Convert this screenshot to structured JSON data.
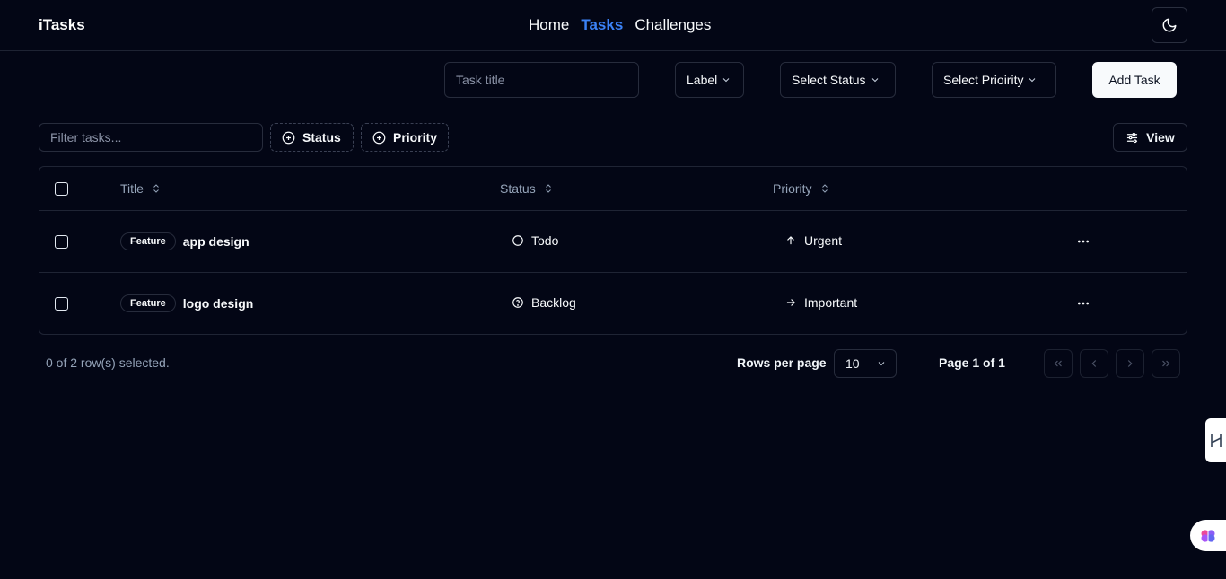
{
  "app": {
    "brand": "iTasks"
  },
  "nav": [
    {
      "label": "Home",
      "active": false
    },
    {
      "label": "Tasks",
      "active": true
    },
    {
      "label": "Challenges",
      "active": false
    }
  ],
  "toolbar": {
    "title_placeholder": "Task title",
    "label_select": "Label",
    "status_select": "Select Status",
    "priority_select": "Select Prioirity",
    "add_button": "Add Task"
  },
  "filters": {
    "filter_placeholder": "Filter tasks...",
    "status_button": "Status",
    "priority_button": "Priority",
    "view_button": "View"
  },
  "table": {
    "columns": [
      "Title",
      "Status",
      "Priority"
    ],
    "rows": [
      {
        "label": "Feature",
        "title": "app design",
        "status": "Todo",
        "status_icon": "circle-icon",
        "priority": "Urgent",
        "priority_icon": "arrow-up-icon"
      },
      {
        "label": "Feature",
        "title": "logo design",
        "status": "Backlog",
        "status_icon": "question-circle-icon",
        "priority": "Important",
        "priority_icon": "arrow-right-icon"
      }
    ]
  },
  "footer": {
    "selected_text": "0 of 2 row(s) selected.",
    "rows_per_page_label": "Rows per page",
    "rows_per_page_value": "10",
    "page_text": "Page 1 of 1"
  },
  "colors": {
    "background": "#030615",
    "accent": "#3b82f6",
    "border": "#272c3c",
    "muted_text": "#94a3b8"
  }
}
